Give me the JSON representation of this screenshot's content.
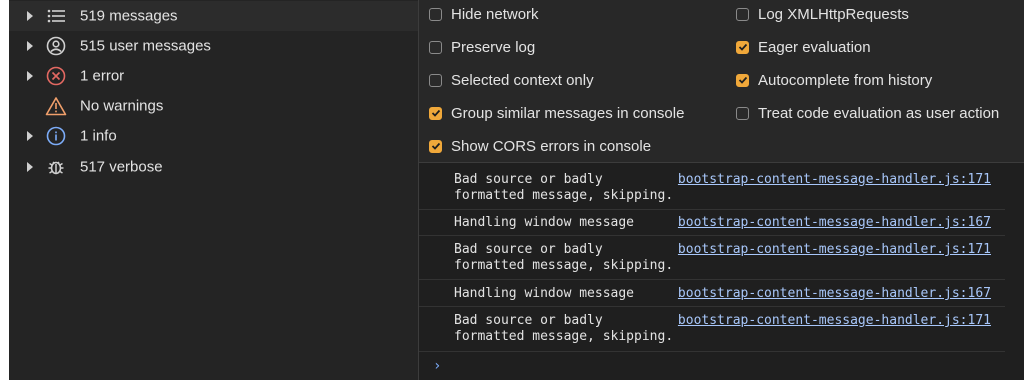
{
  "sidebar": {
    "items": [
      {
        "label": "519 messages",
        "icon": "list-icon",
        "expandable": true,
        "selected": true
      },
      {
        "label": "515 user messages",
        "icon": "user-circle-icon",
        "expandable": true
      },
      {
        "label": "1 error",
        "icon": "error-circle-icon",
        "expandable": true
      },
      {
        "label": "No warnings",
        "icon": "warning-triangle-icon",
        "expandable": false
      },
      {
        "label": "1 info",
        "icon": "info-circle-icon",
        "expandable": true
      },
      {
        "label": "517 verbose",
        "icon": "bug-icon",
        "expandable": true
      }
    ]
  },
  "settings": {
    "left": [
      {
        "label": "Hide network",
        "checked": false
      },
      {
        "label": "Preserve log",
        "checked": false
      },
      {
        "label": "Selected context only",
        "checked": false
      },
      {
        "label": "Group similar messages in console",
        "checked": true
      },
      {
        "label": "Show CORS errors in console",
        "checked": true
      }
    ],
    "right": [
      {
        "label": "Log XMLHttpRequests",
        "checked": false
      },
      {
        "label": "Eager evaluation",
        "checked": true
      },
      {
        "label": "Autocomplete from history",
        "checked": true
      },
      {
        "label": "Treat code evaluation as user action",
        "checked": false
      }
    ]
  },
  "console": {
    "messages": [
      {
        "text": "Bad source or badly\nformatted message, skipping.",
        "source": "bootstrap-content-message-handler.js:171"
      },
      {
        "text": "Handling window message",
        "source": "bootstrap-content-message-handler.js:167"
      },
      {
        "text": "Bad source or badly\nformatted message, skipping.",
        "source": "bootstrap-content-message-handler.js:171"
      },
      {
        "text": "Handling window message",
        "source": "bootstrap-content-message-handler.js:167"
      },
      {
        "text": "Bad source or badly\nformatted message, skipping.",
        "source": "bootstrap-content-message-handler.js:171"
      }
    ],
    "prompt_symbol": "›"
  },
  "colors": {
    "checkbox_on": "#f0a83a",
    "link": "#a8c7fa",
    "error": "#e46962",
    "warning": "#f09f6b",
    "info": "#7cacf8"
  }
}
